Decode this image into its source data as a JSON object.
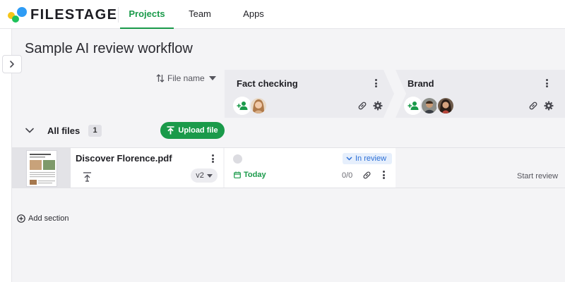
{
  "app": {
    "logo_text": "FILESTAGE"
  },
  "nav": {
    "tabs": [
      {
        "label": "Projects",
        "active": true
      },
      {
        "label": "Team"
      },
      {
        "label": "Apps"
      }
    ]
  },
  "page": {
    "title": "Sample AI review workflow"
  },
  "sort": {
    "label": "File name"
  },
  "steps": [
    {
      "name": "Fact checking",
      "reviewers": [
        "reviewer-woman-avatar"
      ]
    },
    {
      "name": "Brand",
      "reviewers": [
        "reviewer-man-avatar",
        "reviewer-woman-avatar"
      ]
    }
  ],
  "section": {
    "name": "All files",
    "count": "1",
    "upload_label": "Upload file"
  },
  "files": [
    {
      "name": "Discover Florence.pdf",
      "version": "v2",
      "review": {
        "status": "In review",
        "due": "Today",
        "comments": "0/0"
      },
      "next_step_action": "Start review"
    }
  ],
  "add_section_label": "Add section",
  "colors": {
    "brand_green": "#1a9a4a",
    "status_blue": "#2c6fd6",
    "logo_yellow": "#f5c518",
    "logo_green": "#1ec25a",
    "logo_blue": "#2e9cf5"
  }
}
